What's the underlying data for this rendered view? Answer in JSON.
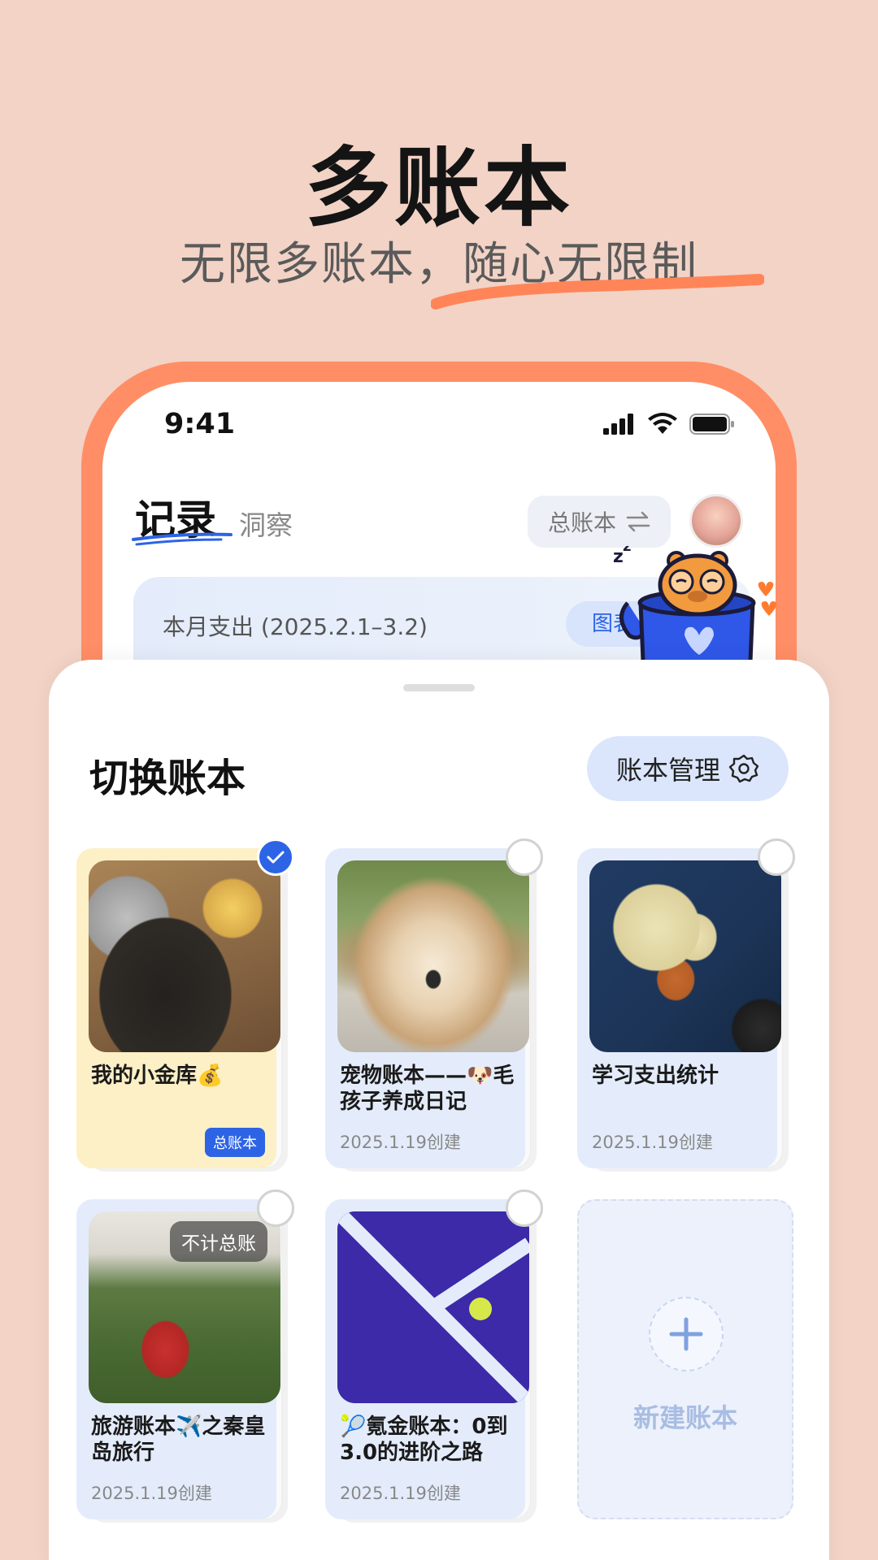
{
  "hero": {
    "title": "多账本",
    "subtitle": "无限多账本，随心无限制"
  },
  "status_bar": {
    "time": "9:41"
  },
  "header": {
    "tab_record": "记录",
    "tab_insight": "洞察",
    "ledger_switch_label": "总账本"
  },
  "month_card": {
    "label": "本月支出 (2025.2.1–3.2)",
    "chart_button": "图表"
  },
  "sheet": {
    "title": "切换账本",
    "manage_button": "账本管理",
    "ledgers": [
      {
        "name": "我的小金库💰",
        "date": "",
        "badge": "总账本",
        "selected": true,
        "tag": ""
      },
      {
        "name": "宠物账本——🐶毛孩子养成日记",
        "date": "2025.1.19创建",
        "badge": "",
        "selected": false,
        "tag": ""
      },
      {
        "name": "学习支出统计",
        "date": "2025.1.19创建",
        "badge": "",
        "selected": false,
        "tag": ""
      },
      {
        "name": "旅游账本✈️之秦皇岛旅行",
        "date": "2025.1.19创建",
        "badge": "",
        "selected": false,
        "tag": "不计总账"
      },
      {
        "name": "🎾氪金账本：0到3.0的进阶之路",
        "date": "2025.1.19创建",
        "badge": "",
        "selected": false,
        "tag": ""
      }
    ],
    "new_ledger_label": "新建账本"
  },
  "colors": {
    "background": "#f2d3c6",
    "frame": "#ff8e66",
    "accent_blue": "#2d64e6"
  }
}
